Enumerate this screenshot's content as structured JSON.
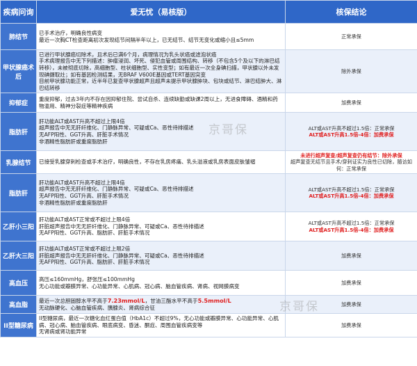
{
  "header": {
    "col1": "疾病问询",
    "col2": "爱无忧（易核版）",
    "col3": "核保结论"
  },
  "watermark": "京哥保",
  "rows": [
    {
      "label": "肺结节",
      "lines": [
        "已手术治疗，明确良性病变",
        "最近一次胸CT检查距离初次发现结节间隔半年以上，已无结节、结节无变化或缩小且≤5mm"
      ],
      "result": [
        "正常承保"
      ]
    },
    {
      "label": "甲状腺癌术后",
      "lines": [
        "已进行甲状腺癌切除术，且术后已满6个月，病理情况为乳头状癌或滤泡状癌",
        "手术病理报告中无下列描述：肿瘤浸润、坏死、侵犯血管或周围结构、转移（不包含5个及以下的淋巴结转移），未被彻底切除，高细胞型、柱状细胞型、实性变型；如有最近一次全身碘扫描，甲状腺以外未发现碘摄取灶；如有基因检测结果，无BRAF V600E基因或TERT基因突变",
        "目前甲状腺功能正常，近半年已复查甲状腺超声且超声未提示甲状腺肿块、包块或结节、淋巴结肿大、淋巴结转移"
      ],
      "result": [
        "除外承保"
      ]
    },
    {
      "label": "抑郁症",
      "lines": [
        "重度抑郁，过去3年内不存在因抑郁住院、尝试自杀、连续缺勤或缺课2周以上，无进食障碍、酒精和药物滥用、精神分裂症等精神疾病"
      ],
      "result": [
        "加费承保"
      ]
    },
    {
      "label": "脂肪肝",
      "lines": [
        "肝功能ALT或AST升高不超过上限4倍",
        "超声报告中无无肝纤维化、门静脉异常、可疑或Ca、恶性待排描述",
        "无AFP阳性、GGT升高、肝脏手术情况",
        "非酒精性脂肪肝或重度脂肪肝"
      ],
      "result": [
        "ALT或AST升高不超过1.5倍：正常承保",
        "ALT或AST升高1.5倍-4倍：加费承保"
      ],
      "result_red": [
        false,
        true
      ]
    },
    {
      "label": "乳腺结节",
      "lines": [
        "已接受乳腺穿刺检查或手术治疗，明确良性，不存在乳房疼痛、乳头溢液或乳房表面皮肤皱褶"
      ],
      "result": [
        "未进行超声复查/超声复查仍有结节：除外承保",
        "超声复查无结节且手术/穿刺证实为良性已切除，随访如何：正常承保"
      ],
      "result_red": [
        true,
        false
      ]
    },
    {
      "label": "脂肪肝",
      "lines": [
        "肝功能ALT或AST升高不超过上限4倍",
        "超声报告中无无肝纤维化、门静脉异常、可疑或Ca、恶性待排描述",
        "无AFP阳性、GGT升高、肝脏手术情况",
        "非酒精性脂肪肝或重度脂肪肝"
      ],
      "result": [
        "ALT或AST升高不超过1.5倍：正常承保",
        "ALT或AST升高1.5倍-4倍：加费承保"
      ],
      "result_red": [
        false,
        true
      ]
    },
    {
      "label": "乙肝小三阳",
      "lines": [
        "肝功能ALT或AST正常或不超过上限4倍",
        "肝脏超声报告中无无肝纤维化、门静脉异常、可疑或Ca、恶性待排描述",
        "无AFP阳性、GGT升高、脂肪肝、肝脏手术情况"
      ],
      "result": [
        "ALT或AST升高不超过1.5倍：正常承保",
        "ALT或AST升高1.5倍-4倍：加费承保"
      ],
      "result_red": [
        false,
        true
      ]
    },
    {
      "label": "乙肝大三阳",
      "lines": [
        "肝功能ALT或AST正常或不超过上限2倍",
        "肝脏超声报告中无无肝纤维化、门静脉异常、可疑或Ca、恶性待排描述",
        "无AFP阳性、GGT升高、脂肪肝、肝脏手术情况"
      ],
      "result": [
        "加费承保"
      ]
    },
    {
      "label": "高血压",
      "lines": [
        "高压≤160mmHg，舒张压≤100mmHg",
        "无心功能或瓣膜异常、心功能异常、心肌病、冠心病、脑血管疾病、肾病、视网膜病变"
      ],
      "result": [
        "加费承保"
      ]
    },
    {
      "label": "高血脂",
      "lines_rich": [
        [
          {
            "t": "最近一次总胆固醇水平不高于"
          },
          {
            "t": "7.23mmol/L",
            "red": true
          },
          {
            "t": "，甘油三酯水平不高于"
          },
          {
            "t": "5.5mmol/L",
            "red": true
          }
        ],
        [
          {
            "t": "无动脉硬化、心脑血管疾病、胰腺炎、肾病综合征"
          }
        ]
      ],
      "result": [
        "加费承保"
      ]
    },
    {
      "label": "II型糖尿病",
      "lines": [
        "II型糖尿病，最近一次糖化血红蛋白值（HbA1c）不超过9%，无心功能或瓣膜异常、心功能异常、心肌病、冠心病、脑血管疾病、眼底病变、昏迷、酮症、周围血管疾病变等",
        "无肾病或肾功能异常"
      ],
      "result": [
        "加费承保"
      ]
    }
  ]
}
